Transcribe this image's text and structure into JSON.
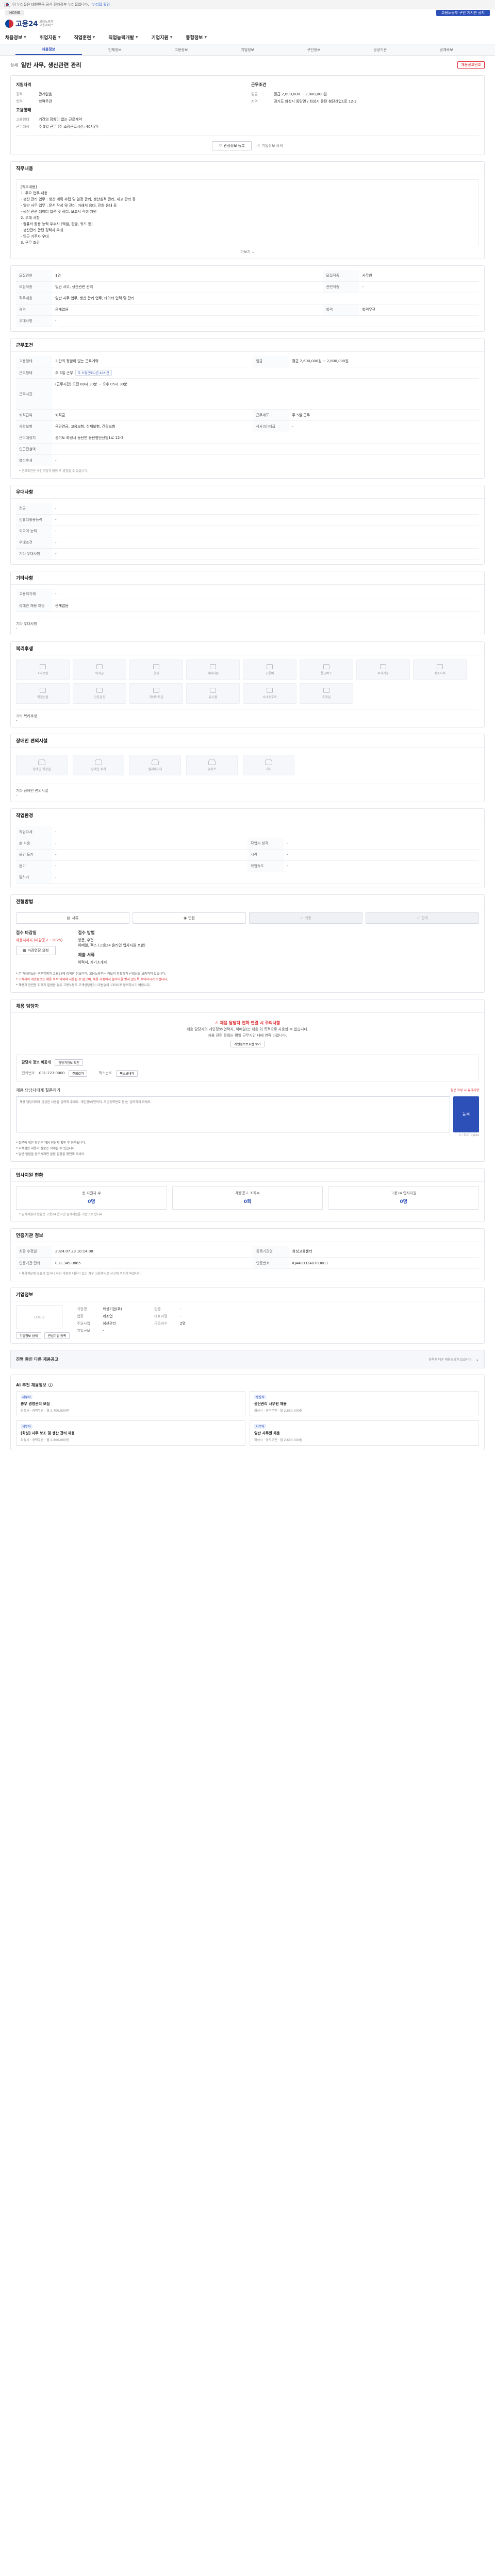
{
  "gov_banner": {
    "text": "이 누리집은 대한민국 공식 전자정부 누리집입니다.",
    "toggle": "누리집 확인"
  },
  "util": {
    "home": "HOME",
    "notice": "고용노동부 구인 게시판 공지"
  },
  "logo": {
    "main": "고용24",
    "sub1": "고용노동부",
    "sub2": "고용서비스"
  },
  "gnb": [
    "채용정보",
    "취업지원",
    "직업훈련",
    "직업능력개발",
    "기업지원",
    "통합정보"
  ],
  "sub_tabs": [
    "채용정보",
    "인재정보",
    "고용정보",
    "기업정보",
    "구인정보",
    "공공기관",
    "공채속보"
  ],
  "job": {
    "company": "상세",
    "title": "일반 사무, 생산관련 관리",
    "urgent": "채용공고번호"
  },
  "summary": {
    "left_title": "지원자격",
    "left": [
      {
        "k": "경력",
        "v": "관계없음"
      },
      {
        "k": "학력",
        "v": "학력무관"
      }
    ],
    "left2_title": "고용형태",
    "left2": [
      {
        "k": "고용형태",
        "v": "기간의 정함이 없는 근로계약"
      },
      {
        "k": "근무예정",
        "v": "주 5일 근무 (주 소정근로시간: 40시간)"
      }
    ],
    "right_title": "근무조건",
    "right": [
      {
        "k": "임금",
        "v": "월급 2,600,000 ~ 2,800,000원"
      },
      {
        "k": "지역",
        "v": "경기도 화성시 동탄면 / 화성시 동탄 첨단산업1로 12-3"
      }
    ],
    "btn_save": "관심정보 등록",
    "btn_report": "기업정보 상세"
  },
  "content": {
    "title": "직무내용",
    "lines": [
      "[직무내용]",
      "1. 주요 업무 내용",
      "- 생산 관리 업무 : 생산 계획 수립 및 일정 관리, 생산실적 관리, 재고 관리 등",
      "- 일반 사무 업무 : 문서 작성 및 관리, 거래처 응대, 전화 응대 등",
      "- 생산 관련 데이터 입력 및 정리, 보고서 작성 지원",
      "2. 우대 사항",
      "- 컴퓨터 활용 능력 우수자 (엑셀, 한글, 워드 등)",
      "- 생산관리 관련 경력자 우대",
      "- 인근 거주자 우대",
      "3. 근무 조건",
      "- 근무시간 : 08:30 ~ 17:30 (휴게시간 1시간)",
      "- 주 5일 근무, 4대보험 가입"
    ],
    "more": "더보기"
  },
  "recruit_table": {
    "rows": [
      {
        "k": "모집인원",
        "v": "1명",
        "k2": "모집직종",
        "v2": "사무원"
      },
      {
        "k": "모집직종",
        "v": "일반 사무, 생산관련 관리",
        "k2": "관련직종",
        "v2": "-"
      },
      {
        "k": "직무내용",
        "v": "일반 사무 업무, 생산 관리 업무, 데이터 입력 및 관리",
        "k2": "",
        "v2": ""
      },
      {
        "k": "경력",
        "v": "관계없음",
        "k2": "학력",
        "v2": "학력무관"
      },
      {
        "k": "우대사항",
        "v": "-",
        "k2": "",
        "v2": ""
      }
    ]
  },
  "work_title": "근무조건",
  "work_table": {
    "rows": [
      {
        "k": "고용형태",
        "v": "기간의 정함이 없는 근로계약",
        "k2": "임금",
        "v2": "월급 2,600,000원 ~ 2,800,000원"
      },
      {
        "k": "근무형태",
        "v": "주 5일 근무",
        "chip": "주 소정근로시간 40시간",
        "k2": "",
        "v2": ""
      },
      {
        "k": "근무시간",
        "v": "(근무시간) 오전 08시 30분 ~ 오후 05시 30분",
        "tall": true,
        "k2": "",
        "v2": ""
      },
      {
        "k": "퇴직급여",
        "v": "퇴직금",
        "k2": "근무제도",
        "v2": "주 5일 근무"
      },
      {
        "k": "사회보험",
        "v": "국민연금, 고용보험, 산재보험, 건강보험",
        "k2": "식사(비)지급",
        "v2": "-"
      },
      {
        "k": "근무예정지",
        "v": "경기도 화성시 동탄면 동탄첨단산업1로 12-3",
        "k2": "",
        "v2": ""
      },
      {
        "k": "인근전철역",
        "v": "-",
        "k2": "",
        "v2": ""
      },
      {
        "k": "복리후생",
        "v": "-",
        "k2": "",
        "v2": ""
      }
    ],
    "footnote": "* 근로조건은 구인기업과 협의 후 결정될 수 있습니다."
  },
  "other_title": "우대사항",
  "other_rows": [
    {
      "k": "전공",
      "v": "-"
    },
    {
      "k": "컴퓨터활용능력",
      "v": "-"
    },
    {
      "k": "외국어 능력",
      "v": "-"
    },
    {
      "k": "우대조건",
      "v": "-"
    },
    {
      "k": "기타 우대사항",
      "v": "-"
    }
  ],
  "misc_title": "기타사항",
  "misc_rows": [
    {
      "k": "고용허가제",
      "v": "-"
    },
    {
      "k": "장애인 채용 희망",
      "v": "관계없음"
    }
  ],
  "misc_note_label": "기타 우대사항",
  "misc_note": "-",
  "benefit_title": "복리후생",
  "benefits": [
    "4대보험",
    "퇴직금",
    "연차",
    "식대지원",
    "교통비",
    "통근버스",
    "주차가능",
    "경조사비",
    "명절선물",
    "건강검진",
    "자녀학자금",
    "유니폼",
    "사내동호회",
    "휴게실",
    "-"
  ],
  "benefit_note_label": "기타 복리후생",
  "benefit_note": "-",
  "welfare_title": "장애인 편의시설",
  "welfare": [
    "장애인 화장실",
    "장애인 주차",
    "엘리베이터",
    "경사로",
    "기타"
  ],
  "welfare_note_label": "기타 장애인 편의시설",
  "welfare_note": "-",
  "env_title": "작업환경",
  "env_rows": [
    {
      "k": "작업자세",
      "v": "-"
    },
    {
      "k": "손 사용",
      "v": "-",
      "k2": "작업시 청각",
      "v2": "-"
    },
    {
      "k": "물건 들기",
      "v": "-",
      "k2": "시력",
      "v2": "-"
    },
    {
      "k": "듣기",
      "v": "-",
      "k2": "작업속도",
      "v2": "-"
    },
    {
      "k": "말하기",
      "v": "-"
    }
  ],
  "process_title": "전형방법",
  "process_steps": [
    "서류",
    "면접",
    "최종",
    "합격"
  ],
  "apply": {
    "deadline_h": "접수 마감일",
    "deadline": "채용시까지 (마감공고 : 2025)",
    "deadline_btn": "마감연장 요청",
    "method_h": "접수 방법",
    "methods": [
      "방문, 우편",
      "이메일, 팩스 (고용24 온라인 입사지원 포함)"
    ],
    "docs_h": "제출 서류",
    "docs": "이력서, 자기소개서"
  },
  "apply_notes": [
    "* 본 채용정보는 구인업체가 고용24에 등록한 정보이며, 고용노동부는 정보의 정확성과 신뢰성을 보증하지 않습니다.",
    "* 구직자의 개인정보는 채용 목적 이외에 사용될 수 없으며, 채용 과정에서 불이익을 받지 않도록 주의하시기 바랍니다.",
    "* 채용과 관련한 피해가 발생한 경우 고용노동부 고객상담센터 (국번없이 1350)로 문의하시기 바랍니다."
  ],
  "manager_title": "채용 담당자",
  "manager": {
    "warn": "채용 담당자 전화 연결 시 주의사항",
    "notice1": "채용 담당자의 개인정보(연락처, 이메일)는 채용 외 목적으로 사용할 수 없습니다.",
    "notice2": "채용 관련 문의는 평일 근무시간 내에 연락 바랍니다.",
    "link": "개인정보보호법 보기",
    "name": "담당자 정보 비공개",
    "name_chip": "담당자정보 확인",
    "phone_label": "전화번호",
    "phone": "031-223-0000",
    "phone_btn": "전화걸기",
    "fax_label": "팩스번호",
    "fax_btn": "팩스보내기"
  },
  "qa": {
    "title": "채용 담당자에게 질문하기",
    "link": "질문 작성 시 유의사항",
    "placeholder": "채용 담당자에게 궁금한 사항을 입력해 주세요. 개인정보(연락처, 주민등록번호 등)는 입력하지 마세요.",
    "counter": "0 / 500 bytes",
    "button": "등록",
    "notes": [
      "* 질문에 대한 답변은 채용 담당자 확인 후 등록됩니다.",
      "* 부적절한 내용의 질문은 삭제될 수 있습니다.",
      "* 답변 알림을 받으시려면 알림 설정을 확인해 주세요."
    ]
  },
  "status_title": "입사지원 현황",
  "status": [
    {
      "label": "총 지원자 수",
      "num": "0명"
    },
    {
      "label": "채용공고 조회수",
      "num": "0회"
    },
    {
      "label": "고용24 입사지원",
      "num": "0명"
    }
  ],
  "status_note": "* 입사지원자 현황은 고용24 온라인 입사지원을 기준으로 합니다.",
  "regist_title": "인증기관 정보",
  "regist_rows": [
    {
      "k": "최종 수정일",
      "v": "2024.07.23 10:14:08",
      "k2": "등록기관명",
      "v2": "화성고용센터"
    },
    {
      "k": "인증기관 전화",
      "v": "031-345-0865",
      "k2": "인증번호",
      "v2": "KJ44003240703003"
    }
  ],
  "regist_note": "* 채용정보에 오류가 있거나 허위·과장된 내용이 있는 경우 고용센터로 신고해 주시기 바랍니다.",
  "company_title": "기업정보",
  "company": {
    "logo": "LOGO",
    "rows": [
      {
        "k": "기업명",
        "v": "화성기업(주)",
        "k2": "업종",
        "v2": "-"
      },
      {
        "k": "업종",
        "v": "제조업",
        "k2": "대표자명",
        "v2": "-"
      },
      {
        "k": "주요사업",
        "v": "생산관리",
        "k2": "근로자수",
        "v2": "2명"
      },
      {
        "k": "기업규모",
        "v": "-",
        "k2": "",
        "v2": ""
      }
    ],
    "btn1": "기업정보 상세",
    "btn2": "관심기업 등록"
  },
  "related_title": "진행 중인 다른 채용공고",
  "related_hint": "등록된 다른 채용공고가 없습니다.",
  "rec_title": "AI 추천 채용정보",
  "rec": [
    {
      "tag": "사무직",
      "title": "총무 경영관리 모집",
      "meta": "화성시 · 경력무관 · 월 2,700,000원"
    },
    {
      "tag": "생산직",
      "title": "생산관리 사무원 채용",
      "meta": "화성시 · 경력무관 · 월 2,650,000원"
    },
    {
      "tag": "사무직",
      "title": "[화성] 사무 보조 및 생산 관리 채용",
      "meta": "화성시 · 경력무관 · 월 2,800,000원"
    },
    {
      "tag": "사무직",
      "title": "일반 사무원 채용",
      "meta": "화성시 · 경력무관 · 월 2,600,000원"
    }
  ]
}
